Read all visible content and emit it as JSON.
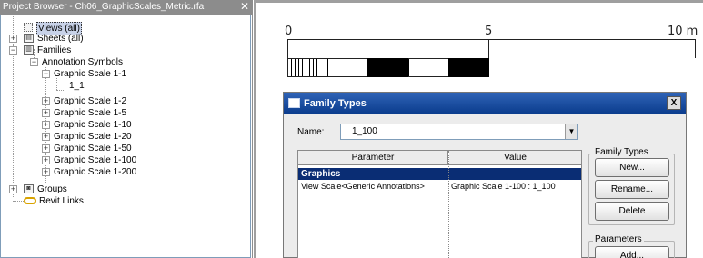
{
  "project_browser": {
    "title": "Project Browser - Ch06_GraphicScales_Metric.rfa",
    "close_glyph": "✕",
    "views_label": "Views (all)",
    "sheets_label": "Sheets (all)",
    "families_label": "Families",
    "annotation_symbols_label": "Annotation Symbols",
    "expanded_family_label": "Graphic Scale 1-1",
    "expanded_type_label": "1_1",
    "collapsed_families": [
      "Graphic Scale 1-2",
      "Graphic Scale 1-5",
      "Graphic Scale 1-10",
      "Graphic Scale 1-20",
      "Graphic Scale 1-50",
      "Graphic Scale 1-100",
      "Graphic Scale 1-200"
    ],
    "groups_label": "Groups",
    "revit_links_label": "Revit Links"
  },
  "canvas": {
    "scale_labels": [
      "0",
      "5",
      "10 m"
    ]
  },
  "dialog": {
    "title": "Family Types",
    "close_glyph": "X",
    "name_label": "Name:",
    "name_value": "1_100",
    "dropdown_glyph": "▼",
    "table": {
      "col_parameter": "Parameter",
      "col_value": "Value",
      "group_label": "Graphics",
      "row_parameter": "View Scale<Generic Annotations>",
      "row_value": "Graphic Scale 1-100 : 1_100"
    },
    "family_types_group_label": "Family Types",
    "new_button": "New...",
    "rename_button": "Rename...",
    "delete_button": "Delete",
    "parameters_group_label": "Parameters",
    "add_button": "Add..."
  },
  "colors": {
    "dialog_title_bar": "#0a3b8c",
    "group_row": "#0a2d74",
    "browser_title_bar": "#8c8c8c"
  }
}
